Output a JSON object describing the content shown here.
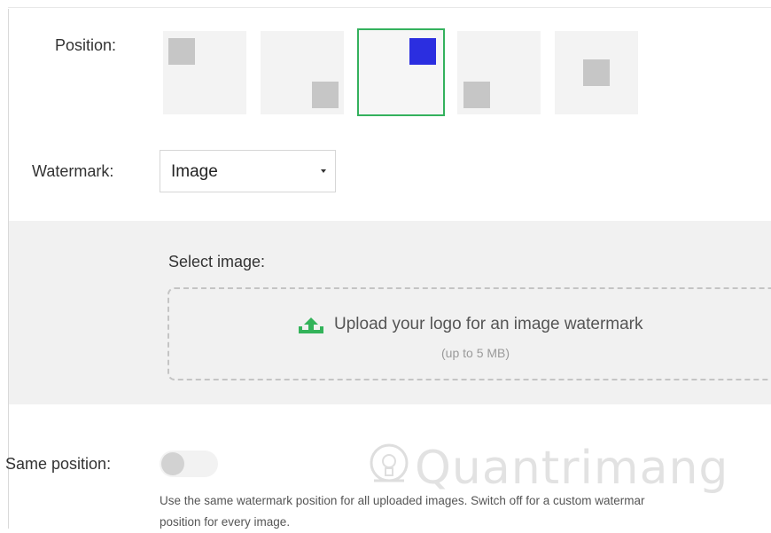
{
  "position": {
    "label": "Position:",
    "selected_index": 2,
    "options": [
      {
        "name": "top-left"
      },
      {
        "name": "bottom-right"
      },
      {
        "name": "top-right"
      },
      {
        "name": "bottom-left"
      },
      {
        "name": "center"
      }
    ]
  },
  "watermark": {
    "label": "Watermark:",
    "selected": "Image"
  },
  "select_image": {
    "label": "Select image:",
    "upload_text": "Upload your logo for an image watermark",
    "upload_sub": "(up to 5 MB)",
    "icon": "upload-icon",
    "accent": "#33b35a"
  },
  "same_position": {
    "label": "Same position:",
    "enabled": false,
    "help_line1": "Use the same watermark position for all uploaded images. Switch off for a custom watermar",
    "help_line2": "position for every image."
  },
  "overlay_watermark": {
    "text": "Quantrimang",
    "icon": "lightbulb-logo"
  },
  "colors": {
    "selected_border": "#34b15d",
    "selected_square": "#2b2ee0",
    "square": "#c6c6c6",
    "thumb_bg": "#f3f3f3",
    "panel_bg": "#f1f1f1"
  }
}
